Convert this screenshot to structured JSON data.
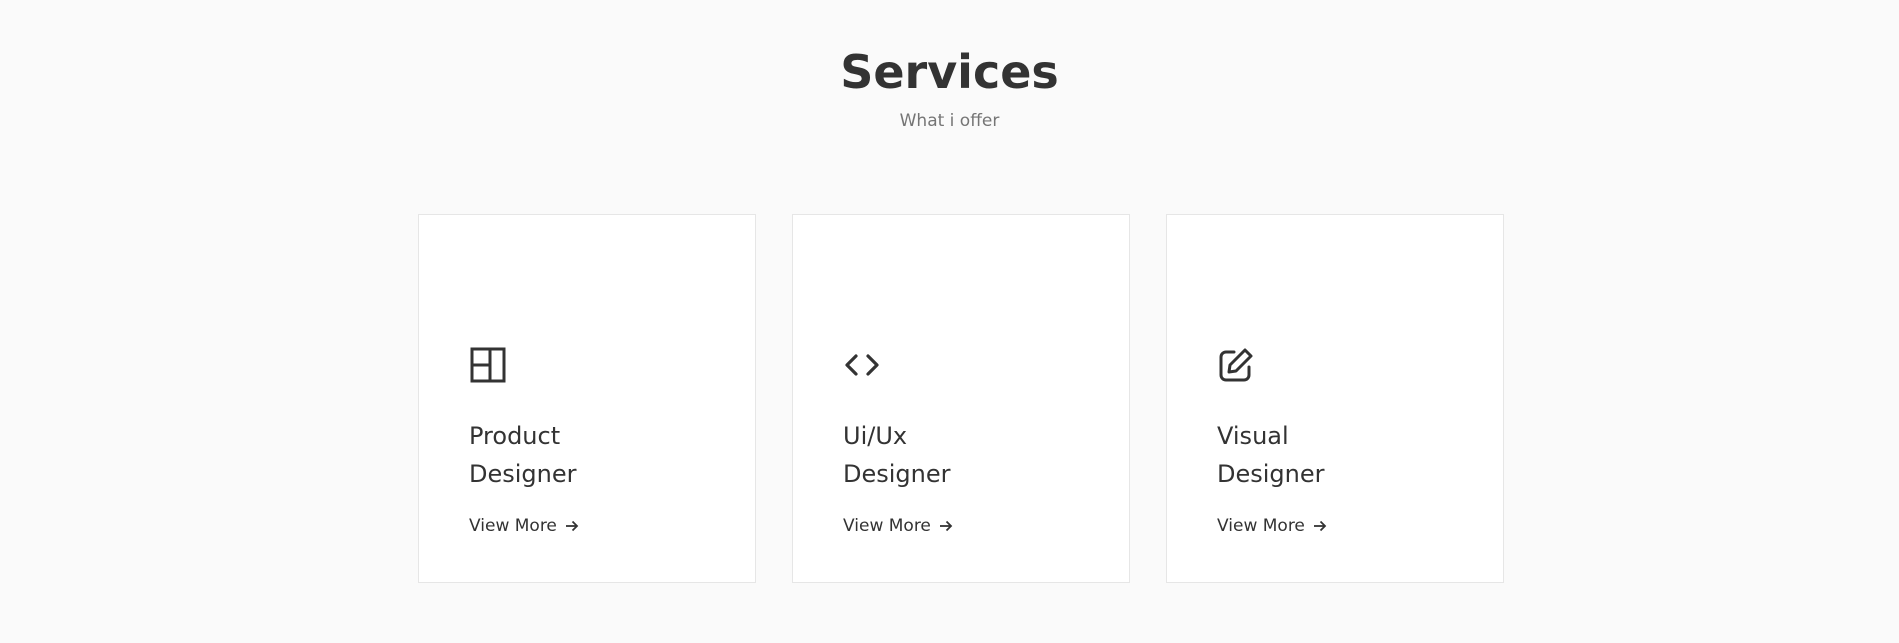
{
  "section": {
    "title": "Services",
    "subtitle": "What i offer"
  },
  "services": [
    {
      "icon": "layout-icon",
      "title_line1": "Product",
      "title_line2": "Designer",
      "link_label": "View More"
    },
    {
      "icon": "code-icon",
      "title_line1": "Ui/Ux",
      "title_line2": "Designer",
      "link_label": "View More"
    },
    {
      "icon": "edit-icon",
      "title_line1": "Visual",
      "title_line2": "Designer",
      "link_label": "View More"
    }
  ],
  "colors": {
    "background": "#fafafa",
    "card": "#ffffff",
    "text": "#333333",
    "muted": "#757575"
  }
}
